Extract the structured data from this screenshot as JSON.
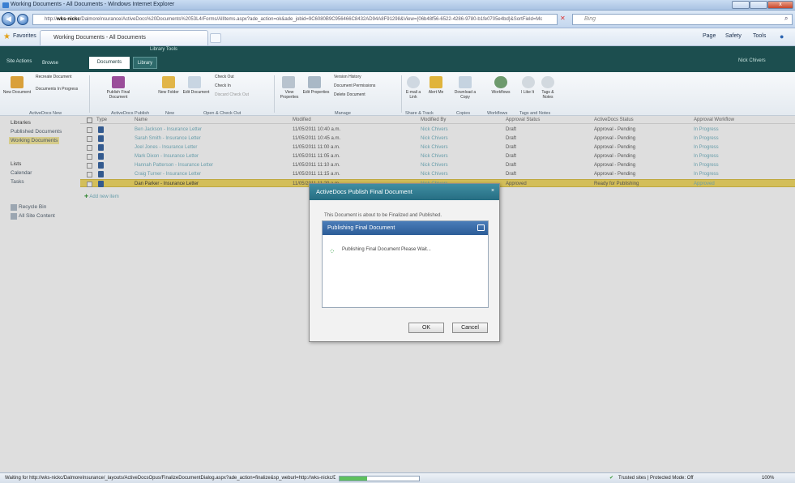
{
  "window": {
    "title": "Working Documents - All Documents - Windows Internet Explorer",
    "min": "",
    "max": "",
    "close": "x"
  },
  "nav": {
    "url_prefix": "http://",
    "url_host": "wks-nickc",
    "url_rest": "/DalmoreInsurance/ActiveDocs%20Documents%2053L4/Forms/AllItems.aspx?ade_action=ok&ade_jobid=9C6080B9C956466C8432AD94A8F91298&View={06b48f56-6522-4286-9780-b1fe0705e4bd}&SortField=Mc",
    "search_placeholder": "Bing"
  },
  "favbar": {
    "favorites": "Favorites",
    "tab": "Working Documents - All Documents",
    "page": "Page",
    "safety": "Safety",
    "tools": "Tools"
  },
  "sp": {
    "library_tools": "Library Tools",
    "site_actions": "Site Actions",
    "browse": "Browse",
    "documents": "Documents",
    "library": "Library",
    "user": "Nick Chivers"
  },
  "ribbon": {
    "recreate": "Recreate Document",
    "in_progress": "Documents In Progress",
    "new_doc": "New Document",
    "publish": "Publish Final Document",
    "new_folder": "New Folder",
    "edit_doc": "Edit Document",
    "check_out": "Check Out",
    "check_in": "Check In",
    "discard": "Discard Check Out",
    "view_props": "View Properties",
    "edit_props": "Edit Properties",
    "version": "Version History",
    "perms": "Document Permissions",
    "delete": "Delete Document",
    "email": "E-mail a Link",
    "alert": "Alert Me",
    "download": "Download a Copy",
    "workflows": "Workflows",
    "like": "I Like It",
    "tags": "Tags & Notes",
    "g_activedocs_new": "ActiveDocs New",
    "g_publish": "ActiveDocs Publish",
    "g_new": "New",
    "g_open": "Open & Check Out",
    "g_manage": "Manage",
    "g_share": "Share & Track",
    "g_copies": "Copies",
    "g_workflows": "Workflows",
    "g_tags": "Tags and Notes"
  },
  "left": {
    "libraries": "Libraries",
    "published": "Published Documents",
    "working": "Working Documents",
    "lists": "Lists",
    "calendar": "Calendar",
    "tasks": "Tasks",
    "recycle": "Recycle Bin",
    "all_site": "All Site Content"
  },
  "headers": {
    "type": "Type",
    "name": "Name",
    "modified": "Modified",
    "modified_by": "Modified By",
    "approval": "Approval Status",
    "ad_status": "ActiveDocs Status",
    "workflow": "Approval Workflow"
  },
  "rows": [
    {
      "name": "Ben Jackson - Insurance Letter",
      "modified": "11/05/2011 10:40 a.m.",
      "by": "Nick Chivers",
      "approval": "Draft",
      "status": "Approval - Pending",
      "wf": "In Progress"
    },
    {
      "name": "Sarah Smith - Insurance Letter",
      "modified": "11/05/2011 10:45 a.m.",
      "by": "Nick Chivers",
      "approval": "Draft",
      "status": "Approval - Pending",
      "wf": "In Progress"
    },
    {
      "name": "Joel Jones - Insurance Letter",
      "modified": "11/05/2011 11:00 a.m.",
      "by": "Nick Chivers",
      "approval": "Draft",
      "status": "Approval - Pending",
      "wf": "In Progress"
    },
    {
      "name": "Mark Dixon - Insurance Letter",
      "modified": "11/05/2011 11:05 a.m.",
      "by": "Nick Chivers",
      "approval": "Draft",
      "status": "Approval - Pending",
      "wf": "In Progress"
    },
    {
      "name": "Hannah Patterson - Insurance Letter",
      "modified": "11/05/2011 11:10 a.m.",
      "by": "Nick Chivers",
      "approval": "Draft",
      "status": "Approval - Pending",
      "wf": "In Progress"
    },
    {
      "name": "Craig Turner - Insurance Letter",
      "modified": "11/05/2011 11:15 a.m.",
      "by": "Nick Chivers",
      "approval": "Draft",
      "status": "Approval - Pending",
      "wf": "In Progress"
    },
    {
      "name": "Dan Parker - Insurance Letter",
      "modified": "11/05/2011 11:20 a.m.",
      "by": "Nick Chivers",
      "approval": "Approved",
      "status": "Ready for Publishing",
      "wf": "Approved"
    }
  ],
  "add_item": "Add new item",
  "dialog": {
    "title": "ActiveDocs Publish Final Document",
    "msg": "This Document is about to be Finalized and Published.",
    "inner_title": "Publishing Final Document",
    "inner_msg": "Publishing Final Document Please Wait...",
    "ok": "OK",
    "cancel": "Cancel"
  },
  "status": {
    "text": "Waiting for http://wks-nickc/DalmoreInsurance/_layouts/ActiveDocsOpus/FinalizeDocumentDialog.aspx?ade_action=finalize&sp_weburl=http://wks-nickc/DalmoreInsurance&sp_listid={061222",
    "progress": 0.35,
    "zone": "Trusted sites | Protected Mode: Off",
    "zoom": "100%"
  }
}
